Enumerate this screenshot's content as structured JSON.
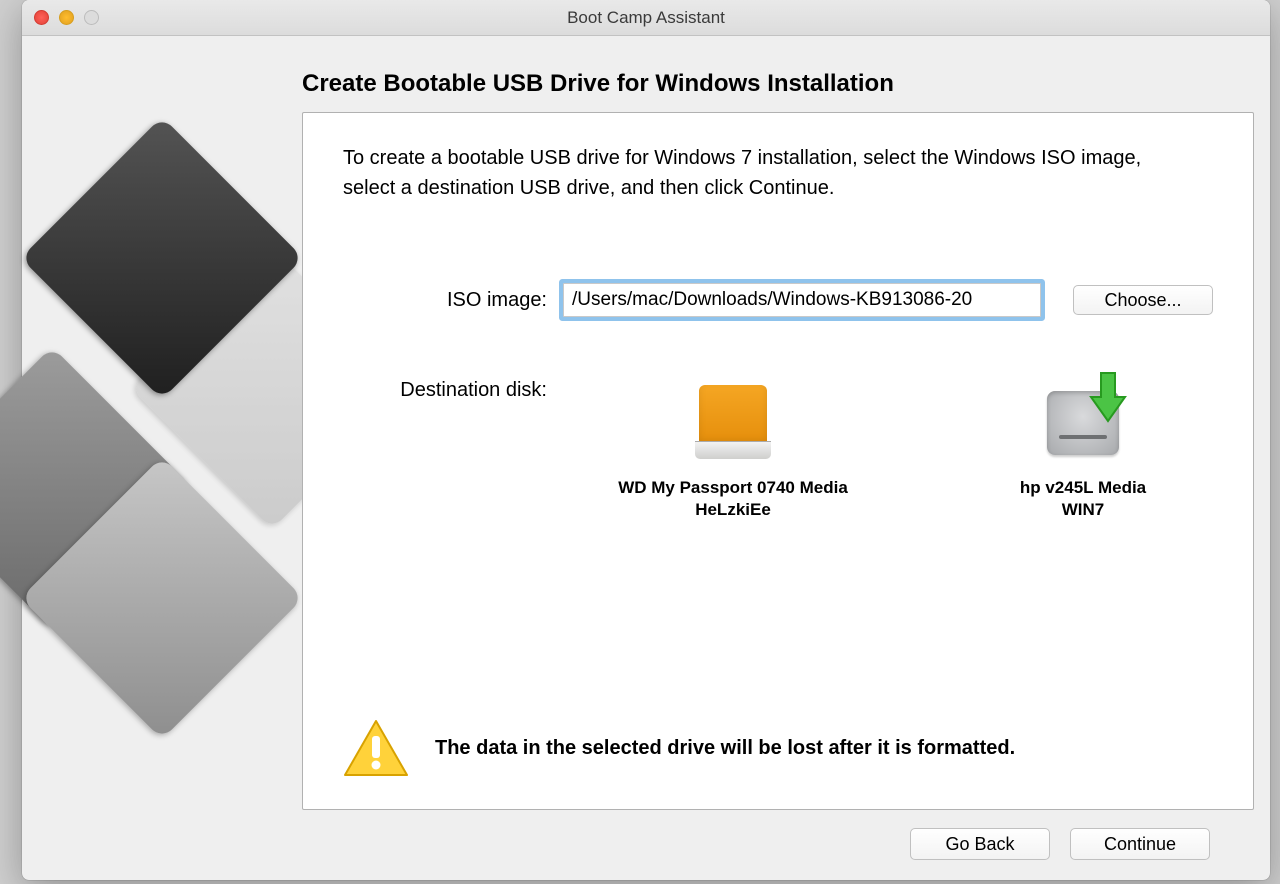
{
  "window": {
    "title": "Boot Camp Assistant"
  },
  "heading": "Create Bootable USB Drive for Windows Installation",
  "intro": "To create a bootable USB drive for Windows 7 installation, select the Windows ISO image, select a destination USB drive, and then click Continue.",
  "iso": {
    "label": "ISO image:",
    "value": "/Users/mac/Downloads/Windows-KB913086-20",
    "choose_label": "Choose..."
  },
  "destination": {
    "label": "Destination disk:",
    "drives": [
      {
        "line1": "WD My Passport 0740 Media",
        "line2": "HeLzkiEe"
      },
      {
        "line1": "hp v245L Media",
        "line2": "WIN7"
      }
    ]
  },
  "warning": "The data in the selected drive will be lost after it is formatted.",
  "footer": {
    "back": "Go Back",
    "continue": "Continue"
  }
}
